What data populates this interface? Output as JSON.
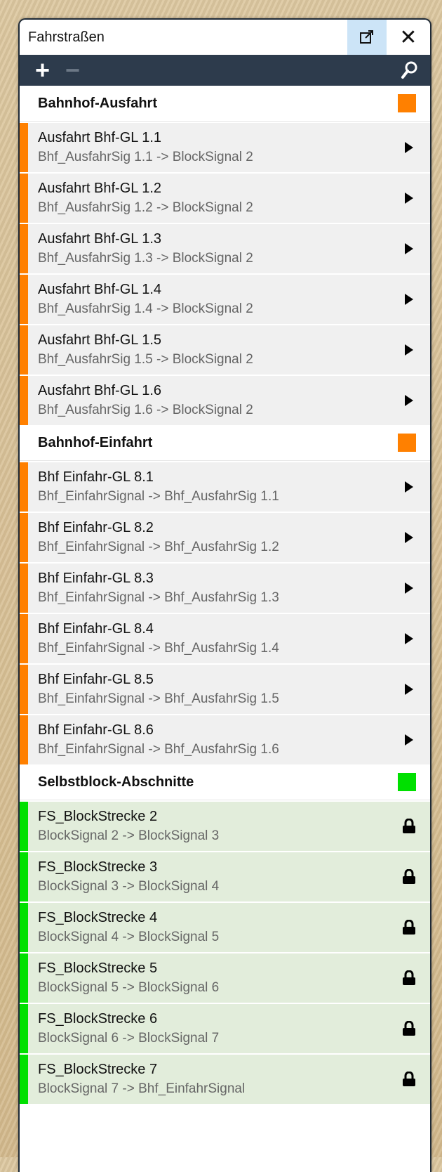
{
  "window": {
    "title": "Fahrstraßen"
  },
  "groups": [
    {
      "title": "Bahnhof-Ausfahrt",
      "color": "#ff8000",
      "rows": [
        {
          "name": "Ausfahrt Bhf-GL 1.1",
          "route": "Bhf_AusfahrSig 1.1 -> BlockSignal 2",
          "action": "play-icon"
        },
        {
          "name": "Ausfahrt Bhf-GL 1.2",
          "route": "Bhf_AusfahrSig 1.2 -> BlockSignal 2",
          "action": "play-icon"
        },
        {
          "name": "Ausfahrt Bhf-GL 1.3",
          "route": "Bhf_AusfahrSig 1.3 -> BlockSignal 2",
          "action": "play-icon"
        },
        {
          "name": "Ausfahrt Bhf-GL 1.4",
          "route": "Bhf_AusfahrSig 1.4 -> BlockSignal 2",
          "action": "play-icon"
        },
        {
          "name": "Ausfahrt Bhf-GL 1.5",
          "route": "Bhf_AusfahrSig 1.5 -> BlockSignal 2",
          "action": "play-icon"
        },
        {
          "name": "Ausfahrt Bhf-GL 1.6",
          "route": "Bhf_AusfahrSig 1.6 -> BlockSignal 2",
          "action": "play-icon"
        }
      ]
    },
    {
      "title": "Bahnhof-Einfahrt",
      "color": "#ff8000",
      "rows": [
        {
          "name": "Bhf Einfahr-GL 8.1",
          "route": "Bhf_EinfahrSignal -> Bhf_AusfahrSig 1.1",
          "action": "play-icon"
        },
        {
          "name": "Bhf Einfahr-GL 8.2",
          "route": "Bhf_EinfahrSignal -> Bhf_AusfahrSig 1.2",
          "action": "play-icon"
        },
        {
          "name": "Bhf Einfahr-GL 8.3",
          "route": "Bhf_EinfahrSignal -> Bhf_AusfahrSig 1.3",
          "action": "play-icon"
        },
        {
          "name": "Bhf Einfahr-GL 8.4",
          "route": "Bhf_EinfahrSignal -> Bhf_AusfahrSig 1.4",
          "action": "play-icon"
        },
        {
          "name": "Bhf Einfahr-GL 8.5",
          "route": "Bhf_EinfahrSignal -> Bhf_AusfahrSig 1.5",
          "action": "play-icon"
        },
        {
          "name": "Bhf Einfahr-GL 8.6",
          "route": "Bhf_EinfahrSignal -> Bhf_AusfahrSig 1.6",
          "action": "play-icon"
        }
      ]
    },
    {
      "title": "Selbstblock-Abschnitte",
      "color": "#00e000",
      "rows": [
        {
          "name": "FS_BlockStrecke 2",
          "route": "BlockSignal 2 -> BlockSignal 3",
          "action": "lock-icon"
        },
        {
          "name": "FS_BlockStrecke 3",
          "route": "BlockSignal 3 -> BlockSignal 4",
          "action": "lock-icon"
        },
        {
          "name": "FS_BlockStrecke 4",
          "route": "BlockSignal 4 -> BlockSignal 5",
          "action": "lock-icon"
        },
        {
          "name": "FS_BlockStrecke 5",
          "route": "BlockSignal 5 -> BlockSignal 6",
          "action": "lock-icon"
        },
        {
          "name": "FS_BlockStrecke 6",
          "route": "BlockSignal 6 -> BlockSignal 7",
          "action": "lock-icon"
        },
        {
          "name": "FS_BlockStrecke 7",
          "route": "BlockSignal 7 -> Bhf_EinfahrSignal",
          "action": "lock-icon"
        }
      ]
    }
  ]
}
